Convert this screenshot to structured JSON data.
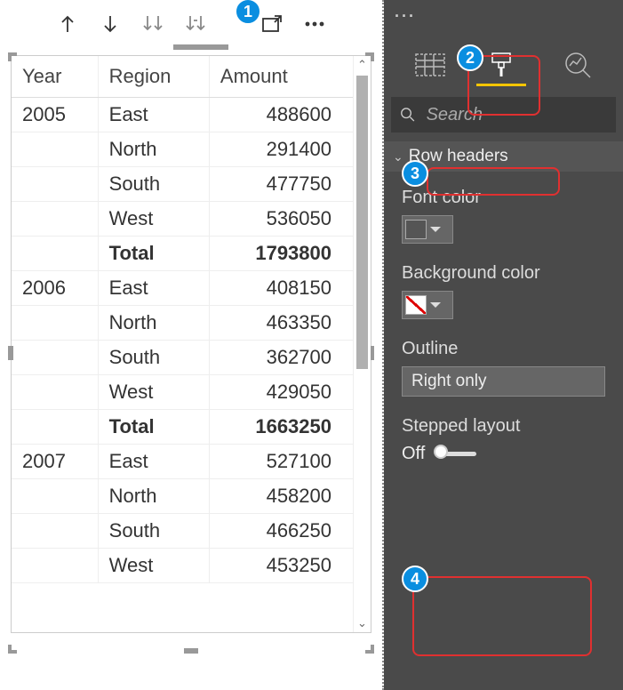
{
  "table": {
    "headers": [
      "Year",
      "Region",
      "Amount"
    ],
    "groups": [
      {
        "year": "2005",
        "rows": [
          {
            "region": "East",
            "amount": "488600"
          },
          {
            "region": "North",
            "amount": "291400"
          },
          {
            "region": "South",
            "amount": "477750"
          },
          {
            "region": "West",
            "amount": "536050"
          }
        ],
        "total_label": "Total",
        "total_amount": "1793800"
      },
      {
        "year": "2006",
        "rows": [
          {
            "region": "East",
            "amount": "408150"
          },
          {
            "region": "North",
            "amount": "463350"
          },
          {
            "region": "South",
            "amount": "362700"
          },
          {
            "region": "West",
            "amount": "429050"
          }
        ],
        "total_label": "Total",
        "total_amount": "1663250"
      },
      {
        "year": "2007",
        "rows": [
          {
            "region": "East",
            "amount": "527100"
          },
          {
            "region": "North",
            "amount": "458200"
          },
          {
            "region": "South",
            "amount": "466250"
          },
          {
            "region": "West",
            "amount": "453250"
          }
        ]
      }
    ]
  },
  "search": {
    "placeholder": "Search"
  },
  "section": {
    "row_headers": "Row headers"
  },
  "fields": {
    "font_color": "Font color",
    "bg_color": "Background color",
    "outline": "Outline",
    "outline_value": "Right only",
    "stepped_layout": "Stepped layout",
    "stepped_state": "Off"
  },
  "callouts": {
    "c1": "1",
    "c2": "2",
    "c3": "3",
    "c4": "4"
  }
}
